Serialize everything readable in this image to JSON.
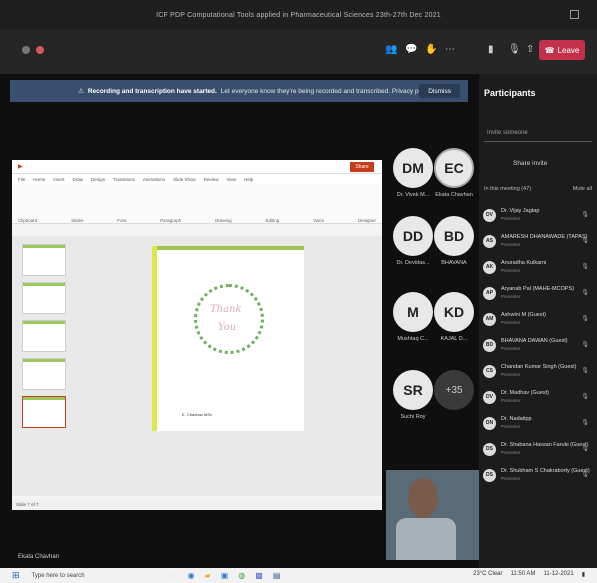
{
  "window": {
    "title": "ICF PDP Computational Tools applied in Pharmaceutical Sciences 23th-27th Dec 2021"
  },
  "toolbar": {
    "timer": "",
    "leave_label": "Leave"
  },
  "banner": {
    "title": "Recording and transcription have started.",
    "text": "Let everyone know they're being recorded and transcribed. Privacy policy",
    "dismiss": "Dismiss"
  },
  "share": {
    "app_title": "",
    "tabs": [
      "File",
      "Home",
      "Insert",
      "Draw",
      "Design",
      "Transitions",
      "Animations",
      "Slide Show",
      "Review",
      "View",
      "Help"
    ],
    "ribbon": [
      "Clipboard",
      "Slides",
      "Font",
      "Paragraph",
      "Drawing",
      "Editing",
      "Voice",
      "Designer"
    ],
    "slide_text1": "Thank",
    "slide_text2": "You",
    "caption": "E. Chavhan  MSc",
    "status": "Slide 7 of 7"
  },
  "participants": [
    {
      "initials": "DM",
      "name": "Dr. Vivek M..."
    },
    {
      "initials": "EC",
      "name": "Ekata Chavhan"
    },
    {
      "initials": "DD",
      "name": "Dr. Devidas..."
    },
    {
      "initials": "BD",
      "name": "BHAVANA"
    },
    {
      "initials": "M",
      "name": "Mushtaq C..."
    },
    {
      "initials": "KD",
      "name": "KAJAL D..."
    },
    {
      "initials": "SR",
      "name": "Suchi Roy"
    },
    {
      "initials": "+35",
      "name": ""
    }
  ],
  "video": {
    "speaker": "Ekata Chavhan"
  },
  "pane": {
    "title": "Participants",
    "invite_placeholder": "Invite someone",
    "share_invite": "Share invite",
    "meeting_label": "In this meeting (47)",
    "mute_all": "Mute all",
    "list": [
      {
        "initials": "DV",
        "name": "Dr. Vijay Jagtap",
        "role": "Presenter"
      },
      {
        "initials": "AS",
        "name": "AMARESH DHANAWADE (TAPAS)",
        "role": "Presenter"
      },
      {
        "initials": "AK",
        "name": "Anuradha Kulkarni",
        "role": "Presenter"
      },
      {
        "initials": "AP",
        "name": "Aryanab Pal (MAHE-MCOPS)",
        "role": "Presenter"
      },
      {
        "initials": "AM",
        "name": "Ashwini M (Guest)",
        "role": "Presenter"
      },
      {
        "initials": "BD",
        "name": "BHAVANA DAWAN (Guest)",
        "role": "Presenter"
      },
      {
        "initials": "CS",
        "name": "Chandan Kumar Singh (Guest)",
        "role": "Presenter"
      },
      {
        "initials": "DV",
        "name": "Dr. Madhav (Guest)",
        "role": "Presenter"
      },
      {
        "initials": "DN",
        "name": "Dr. Nadatipp",
        "role": "Presenter"
      },
      {
        "initials": "DS",
        "name": "Dr. Shabana Hassan Faruki (Guest)",
        "role": "Presenter"
      },
      {
        "initials": "DS",
        "name": "Dr. Shubham S Chakraborty (Guest)",
        "role": "Presenter"
      }
    ]
  },
  "taskbar": {
    "search": "Type here to search",
    "weather": "23°C Clear",
    "time": "11:50 AM",
    "date": "11-12-2021"
  }
}
